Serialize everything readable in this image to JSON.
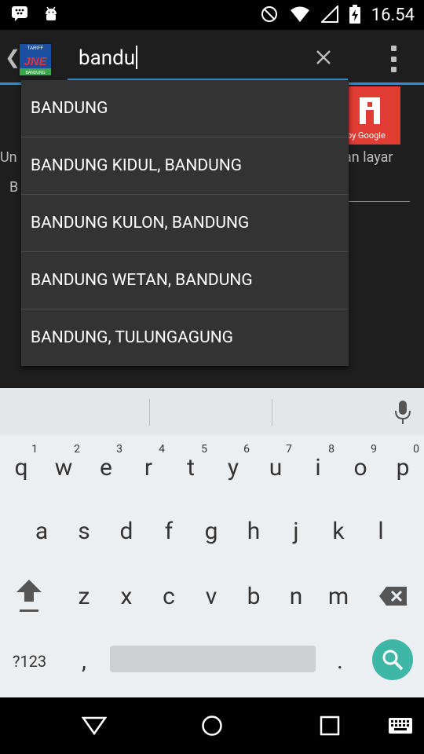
{
  "status_bar": {
    "time": "16.54",
    "left_icons": [
      "bbm-icon",
      "android-icon"
    ],
    "right_icons": [
      "do-not-disturb-icon",
      "wifi-icon",
      "signal-icon",
      "battery-charging-icon"
    ]
  },
  "toolbar": {
    "search_value": "bandu",
    "logo_text_top": "TARIFF",
    "logo_text_main": "JNE",
    "logo_text_bottom": "BANDUNG"
  },
  "suggestions": [
    "BANDUNG",
    "BANDUNG KIDUL, BANDUNG",
    "BANDUNG KULON, BANDUNG",
    "BANDUNG WETAN, BANDUNG",
    "BANDUNG, TULUNGAGUNG"
  ],
  "background_content": {
    "left_text_1": "Un",
    "left_text_2": "B",
    "right_text_1": "an layar",
    "ad_caption": "by Google"
  },
  "keyboard": {
    "row1": [
      {
        "key": "q",
        "hint": "1"
      },
      {
        "key": "w",
        "hint": "2"
      },
      {
        "key": "e",
        "hint": "3"
      },
      {
        "key": "r",
        "hint": "4"
      },
      {
        "key": "t",
        "hint": "5"
      },
      {
        "key": "y",
        "hint": "6"
      },
      {
        "key": "u",
        "hint": "7"
      },
      {
        "key": "i",
        "hint": "8"
      },
      {
        "key": "o",
        "hint": "9"
      },
      {
        "key": "p",
        "hint": "0"
      }
    ],
    "row2": [
      "a",
      "s",
      "d",
      "f",
      "g",
      "h",
      "j",
      "k",
      "l"
    ],
    "row3": [
      "z",
      "x",
      "c",
      "v",
      "b",
      "n",
      "m"
    ],
    "symbols_label": "?123",
    "comma": ",",
    "period": "."
  },
  "colors": {
    "accent": "#2b8fd6",
    "enter_key": "#3fb7a6",
    "dropdown_bg": "#333333",
    "keyboard_bg": "#eceff1"
  }
}
